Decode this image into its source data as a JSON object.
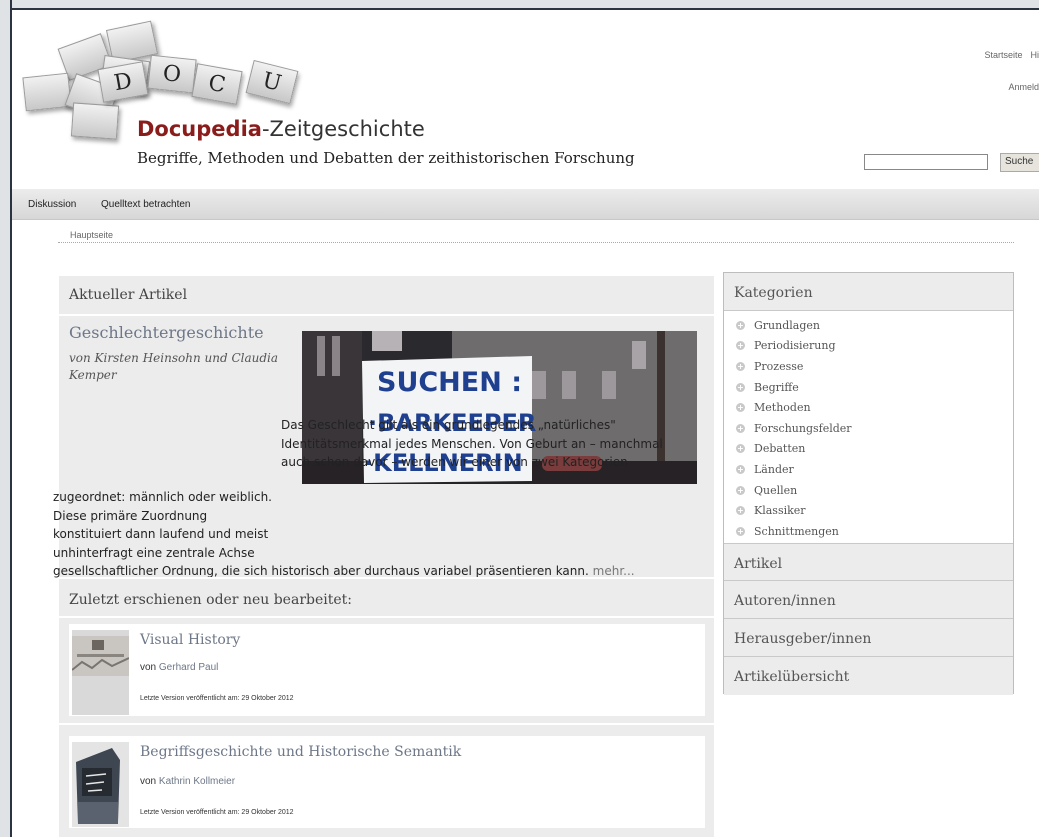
{
  "site": {
    "brand_bold": "Docupedia",
    "brand_rest": "-Zeitgeschichte",
    "tagline": "Begriffe, Methoden und Debatten der zeithistorischen Forschung",
    "logo_tiles": [
      "D",
      "O",
      "C",
      "U"
    ]
  },
  "header": {
    "links": [
      "Startseite",
      "Hi"
    ],
    "login": "Anmeld",
    "search_button": "Suche"
  },
  "tabs": [
    "Diskussion",
    "Quelltext betrachten"
  ],
  "breadcrumb": "Hauptseite",
  "current_article": {
    "section_title": "Aktueller Artikel",
    "title": "Geschlechtergeschichte",
    "authors": "von Kirsten Heinsohn und Claudia Kemper",
    "image_lines": [
      "SUCHEN :",
      "·BARKEEPER",
      "·KELLNERIN"
    ],
    "teaser": "Das Geschlecht gilt als ein grundlegendes „natürliches\" Identitätsmerkmal jedes Menschen. Von Geburt an – manchmal auch schon davor – werden wir einer von zwei Kategorien zugeordnet: männlich oder weiblich. Diese primäre Zuordnung konstituiert dann laufend und meist unhinterfragt eine zentrale Achse gesellschaftlicher Ordnung, die sich historisch aber durchaus variabel präsentieren kann.",
    "more_label": "mehr..."
  },
  "recent": {
    "section_title": "Zuletzt erschienen oder neu bearbeitet:",
    "items": [
      {
        "title": "Visual History",
        "author_prefix": "von",
        "author": "Gerhard Paul",
        "date": "Letzte Version veröffentlicht am: 29 Oktober 2012"
      },
      {
        "title": "Begriffsgeschichte und Historische Semantik",
        "author_prefix": "von",
        "author": "Kathrin Kollmeier",
        "date": "Letzte Version veröffentlicht am: 29 Oktober 2012"
      }
    ]
  },
  "sidebar": {
    "categories_title": "Kategorien",
    "categories": [
      "Grundlagen",
      "Periodisierung",
      "Prozesse",
      "Begriffe",
      "Methoden",
      "Forschungsfelder",
      "Debatten",
      "Länder",
      "Quellen",
      "Klassiker",
      "Schnittmengen"
    ],
    "sections": [
      "Artikel",
      "Autoren/innen",
      "Herausgeber/innen",
      "Artikelübersicht"
    ]
  },
  "colors": {
    "brand_red": "#8a1c1c",
    "link_grey_blue": "#6d7788",
    "panel_grey": "#ececec"
  }
}
